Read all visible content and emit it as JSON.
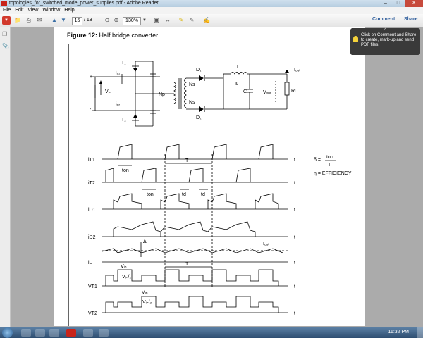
{
  "window": {
    "title": "topologies_for_switched_mode_power_supplies.pdf - Adobe Reader"
  },
  "menu": [
    "File",
    "Edit",
    "View",
    "Window",
    "Help"
  ],
  "toolbar": {
    "page_current": "16",
    "page_total": "/ 18",
    "zoom": "130%",
    "comment": "Comment",
    "share": "Share"
  },
  "tooltip": {
    "arrow": "^",
    "text": "Click on Comment and Share to create, mark-up and send PDF files."
  },
  "document": {
    "figure_label": "Figure 12:",
    "figure_title": "Half bridge converter",
    "circuit": {
      "T1": "T₁",
      "T2": "T₂",
      "iT1": "i₁₁",
      "iT2": "iₜ₂",
      "Vin": "Vᵢₙ",
      "Np": "Np",
      "Ns_top": "Ns",
      "Ns_bottom": "Ns",
      "D1": "D₁",
      "D2": "D₂",
      "L": "L",
      "IL": "Iʟ",
      "C": "C",
      "Vout": "Vₒᵤₜ",
      "RL": "Rʟ",
      "Iout": "Iₒᵤₜ",
      "plus": "+",
      "minus": "-"
    },
    "waveforms": {
      "labels": [
        "iT1",
        "iT2",
        "iD1",
        "iD2",
        "iL",
        "VT1",
        "VT2"
      ],
      "t": "t",
      "ton": "ton",
      "T": "T",
      "td": "td",
      "delta_i": "Δi",
      "iout": "Iₒᵤₜ",
      "vin": "Vᵢₙ",
      "vin_half": "Vᵢₙ/₂"
    },
    "legend": {
      "delta": "δ =",
      "ton": "ton",
      "T": "T",
      "eta": "η = EFFICIENCY"
    }
  },
  "taskbar": {
    "time": "11:32 PM"
  }
}
